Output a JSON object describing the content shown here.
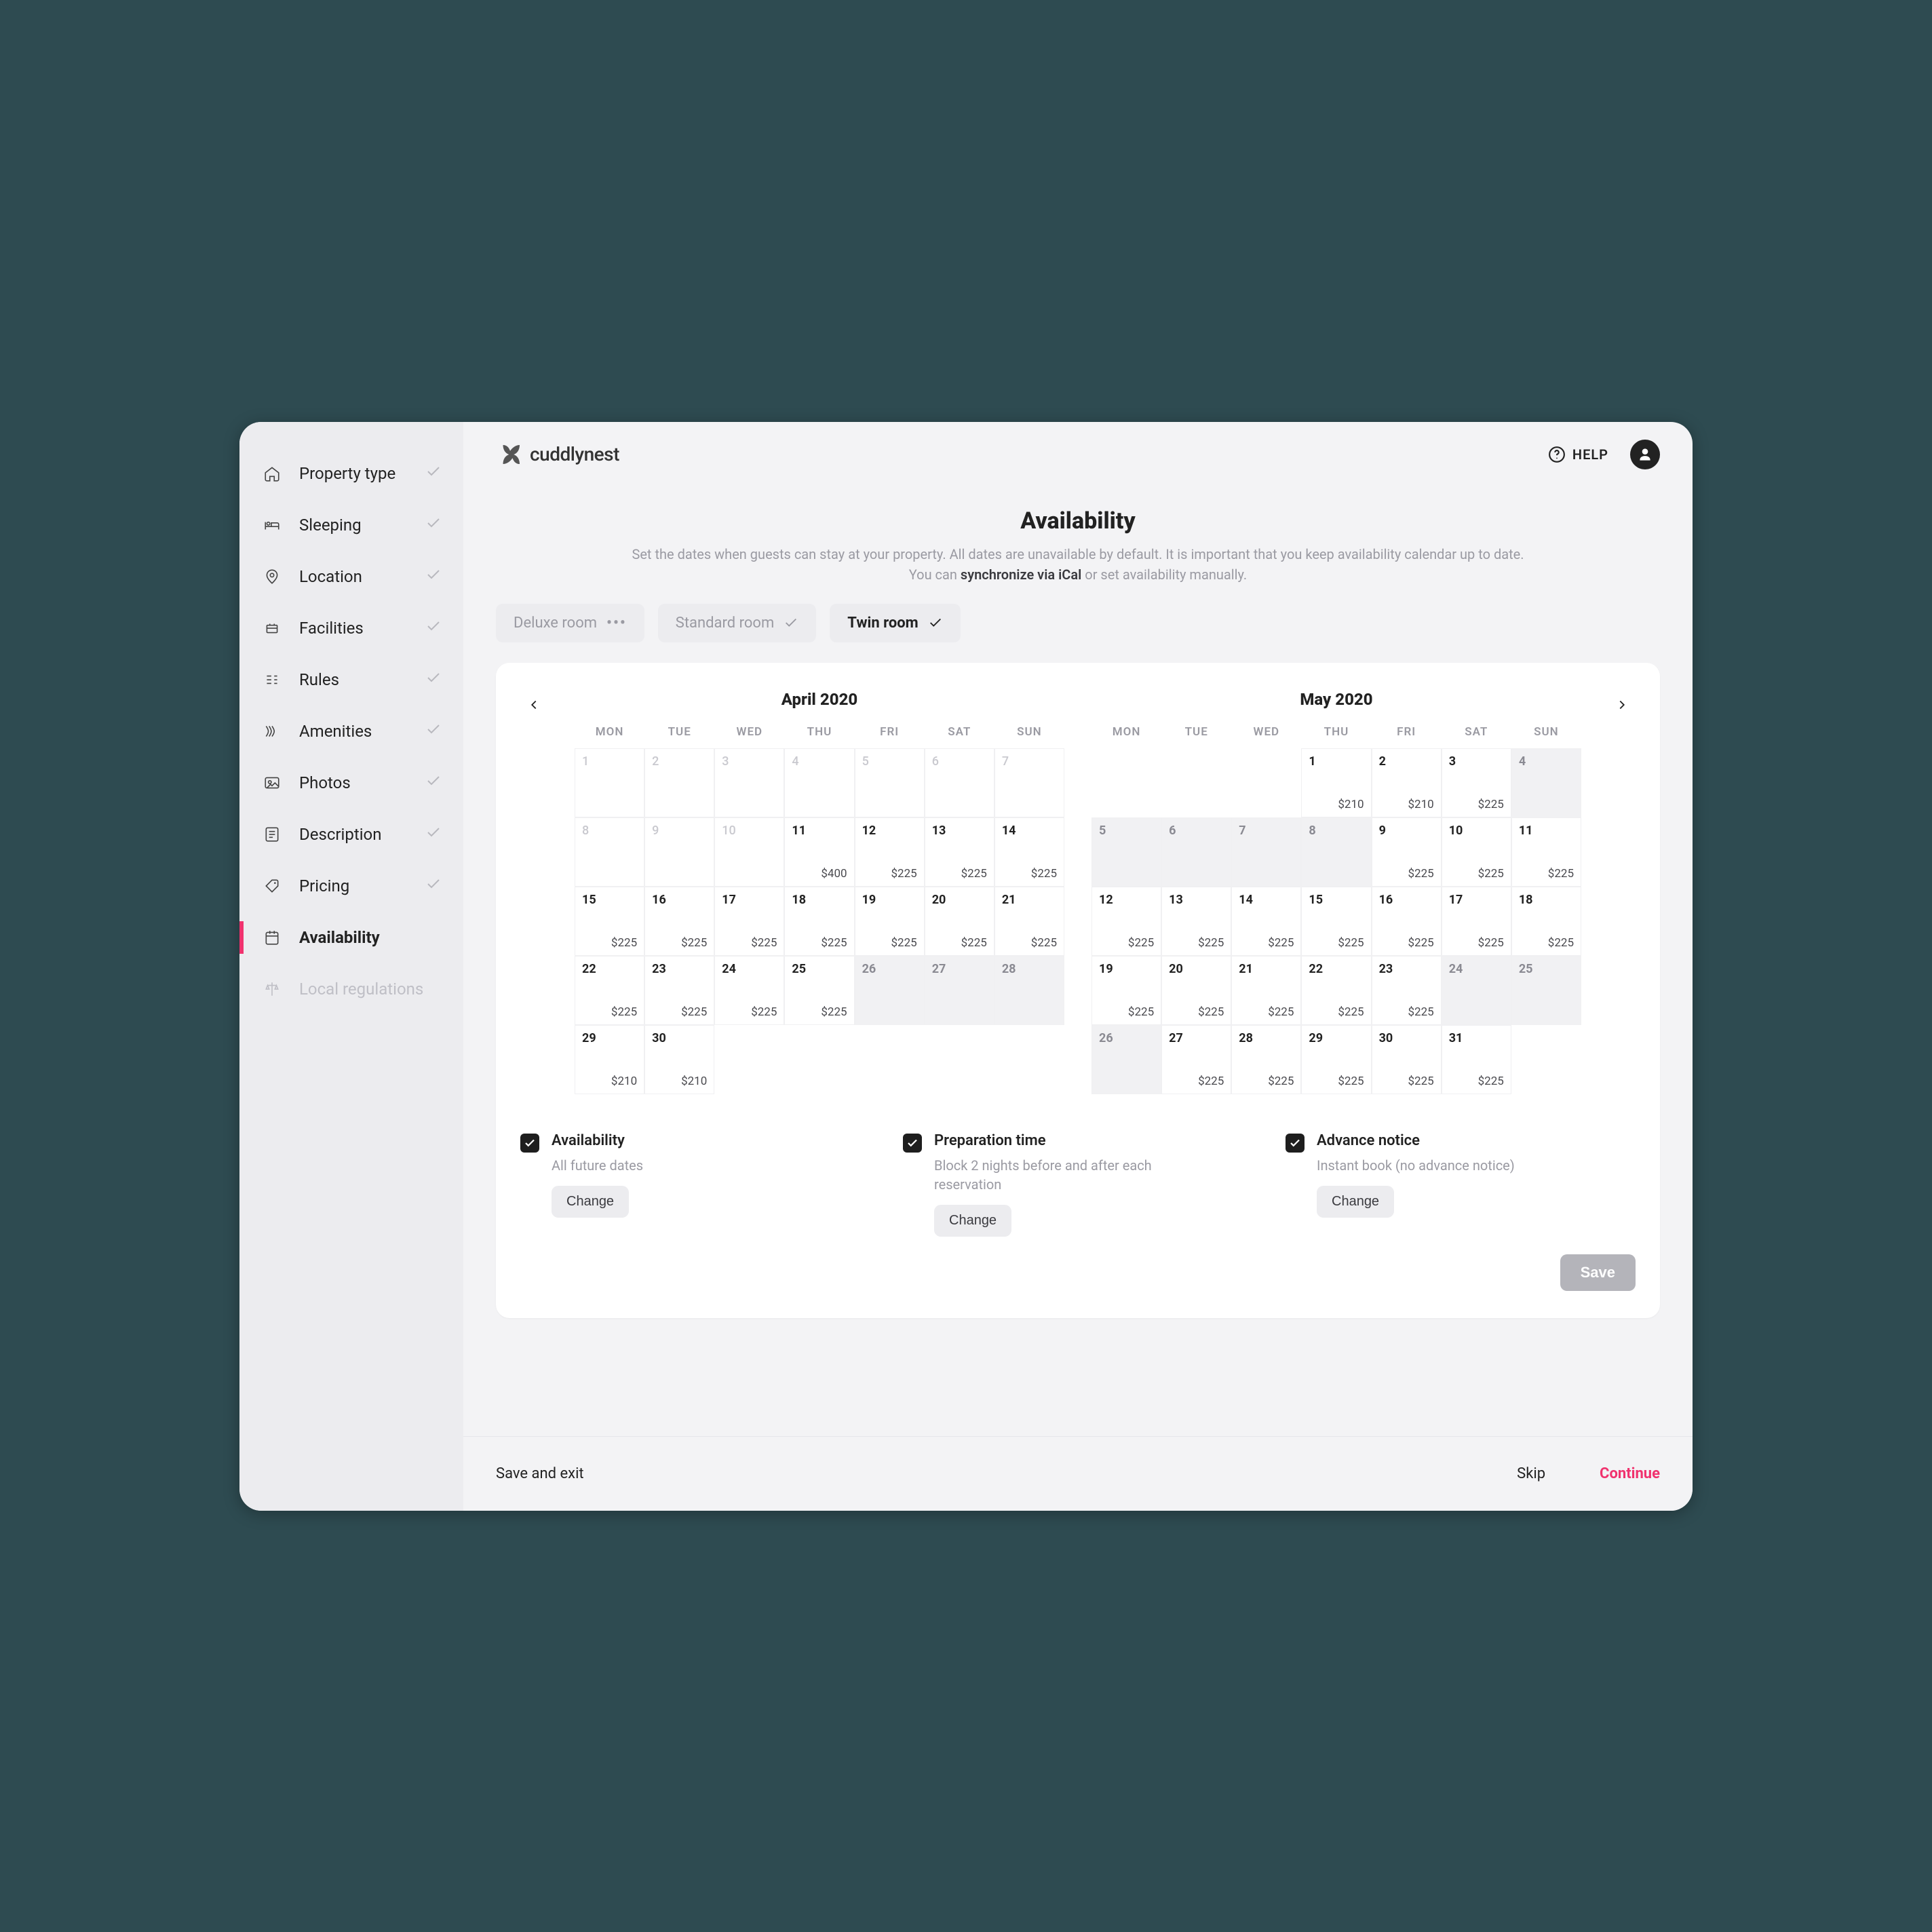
{
  "brand": {
    "name": "cuddlynest"
  },
  "header": {
    "help": "HELP"
  },
  "sidebar": {
    "items": [
      {
        "id": "property-type",
        "label": "Property type",
        "done": true
      },
      {
        "id": "sleeping",
        "label": "Sleeping",
        "done": true
      },
      {
        "id": "location",
        "label": "Location",
        "done": true
      },
      {
        "id": "facilities",
        "label": "Facilities",
        "done": true
      },
      {
        "id": "rules",
        "label": "Rules",
        "done": true
      },
      {
        "id": "amenities",
        "label": "Amenities",
        "done": true
      },
      {
        "id": "photos",
        "label": "Photos",
        "done": true
      },
      {
        "id": "description",
        "label": "Description",
        "done": true
      },
      {
        "id": "pricing",
        "label": "Pricing",
        "done": true
      },
      {
        "id": "availability",
        "label": "Availability",
        "active": true
      },
      {
        "id": "local-regs",
        "label": "Local regulations",
        "disabled": true
      }
    ]
  },
  "page": {
    "title": "Availability",
    "desc_a": "Set the dates when guests can stay at your property. All dates are unavailable by default. It is important that you keep availability calendar up to date.",
    "desc_b_pre": "You can ",
    "desc_b_strong": "synchronize via iCal",
    "desc_b_post": " or set availability manually."
  },
  "room_tabs": [
    {
      "id": "deluxe",
      "label": "Deluxe room",
      "state": "pending"
    },
    {
      "id": "standard",
      "label": "Standard room",
      "state": "done"
    },
    {
      "id": "twin",
      "label": "Twin room",
      "state": "active-done"
    }
  ],
  "dow": [
    "MON",
    "TUE",
    "WED",
    "THU",
    "FRI",
    "SAT",
    "SUN"
  ],
  "months": [
    {
      "title": "April 2020",
      "lead": 0,
      "days": [
        {
          "n": 1,
          "dim": true
        },
        {
          "n": 2,
          "dim": true
        },
        {
          "n": 3,
          "dim": true
        },
        {
          "n": 4,
          "dim": true
        },
        {
          "n": 5,
          "dim": true
        },
        {
          "n": 6,
          "dim": true
        },
        {
          "n": 7,
          "dim": true
        },
        {
          "n": 8,
          "dim": true
        },
        {
          "n": 9,
          "dim": true
        },
        {
          "n": 10,
          "dim": true
        },
        {
          "n": 11,
          "price": "$400"
        },
        {
          "n": 12,
          "price": "$225"
        },
        {
          "n": 13,
          "price": "$225"
        },
        {
          "n": 14,
          "price": "$225"
        },
        {
          "n": 15,
          "price": "$225"
        },
        {
          "n": 16,
          "price": "$225"
        },
        {
          "n": 17,
          "price": "$225"
        },
        {
          "n": 18,
          "price": "$225"
        },
        {
          "n": 19,
          "price": "$225"
        },
        {
          "n": 20,
          "price": "$225"
        },
        {
          "n": 21,
          "price": "$225"
        },
        {
          "n": 22,
          "price": "$225"
        },
        {
          "n": 23,
          "price": "$225"
        },
        {
          "n": 24,
          "price": "$225"
        },
        {
          "n": 25,
          "price": "$225"
        },
        {
          "n": 26,
          "shade": true
        },
        {
          "n": 27,
          "shade": true
        },
        {
          "n": 28,
          "shade": true
        },
        {
          "n": 29,
          "price": "$210"
        },
        {
          "n": 30,
          "price": "$210"
        }
      ]
    },
    {
      "title": "May 2020",
      "lead": 3,
      "days": [
        {
          "n": 1,
          "price": "$210"
        },
        {
          "n": 2,
          "price": "$210"
        },
        {
          "n": 3,
          "price": "$225"
        },
        {
          "n": 4,
          "shade": true
        },
        {
          "n": 5,
          "shade": true
        },
        {
          "n": 6,
          "shade": true
        },
        {
          "n": 7,
          "shade": true
        },
        {
          "n": 8,
          "shade": true
        },
        {
          "n": 9,
          "price": "$225"
        },
        {
          "n": 10,
          "price": "$225"
        },
        {
          "n": 11,
          "price": "$225"
        },
        {
          "n": 12,
          "price": "$225"
        },
        {
          "n": 13,
          "price": "$225"
        },
        {
          "n": 14,
          "price": "$225"
        },
        {
          "n": 15,
          "price": "$225"
        },
        {
          "n": 16,
          "price": "$225"
        },
        {
          "n": 17,
          "price": "$225"
        },
        {
          "n": 18,
          "price": "$225"
        },
        {
          "n": 19,
          "price": "$225"
        },
        {
          "n": 20,
          "price": "$225"
        },
        {
          "n": 21,
          "price": "$225"
        },
        {
          "n": 22,
          "price": "$225"
        },
        {
          "n": 23,
          "price": "$225"
        },
        {
          "n": 24,
          "shade": true
        },
        {
          "n": 25,
          "shade": true
        },
        {
          "n": 26,
          "shade": true
        },
        {
          "n": 27,
          "price": "$225"
        },
        {
          "n": 28,
          "price": "$225"
        },
        {
          "n": 29,
          "price": "$225"
        },
        {
          "n": 30,
          "price": "$225"
        },
        {
          "n": 31,
          "price": "$225"
        }
      ]
    }
  ],
  "options": {
    "availability": {
      "title": "Availability",
      "sub": "All future dates",
      "btn": "Change"
    },
    "preparation": {
      "title": "Preparation time",
      "sub": "Block 2 nights before and after each reservation",
      "btn": "Change"
    },
    "advance": {
      "title": "Advance notice",
      "sub": "Instant book (no advance notice)",
      "btn": "Change"
    }
  },
  "buttons": {
    "save": "Save",
    "save_exit": "Save and exit",
    "skip": "Skip",
    "continue": "Continue"
  }
}
